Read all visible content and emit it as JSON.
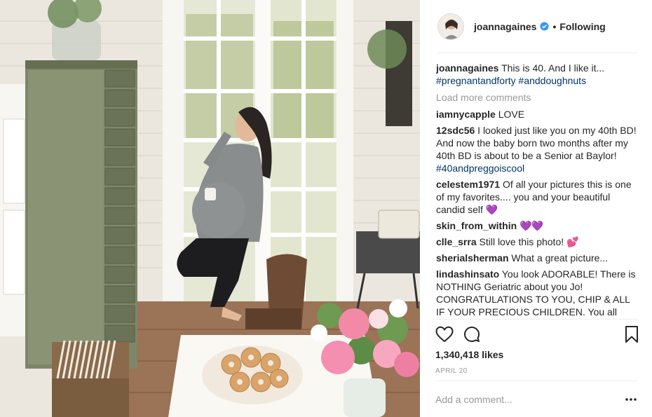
{
  "post": {
    "username": "joannagaines",
    "follow_state": "Following",
    "dot": "•",
    "caption": {
      "username": "joannagaines",
      "text": "This is 40. And I like it...",
      "hashtags": [
        "#pregnantandforty",
        "#anddoughnuts"
      ]
    },
    "load_more_label": "Load more comments",
    "comments": [
      {
        "username": "iamnycapple",
        "text": "LOVE",
        "tag": "",
        "emoji": ""
      },
      {
        "username": "12sdc56",
        "text": "I looked just like you on my 40th BD! And now the baby born two months after my 40th BD is about to be a Senior at Baylor!",
        "tag": "#40andpreggoiscool",
        "emoji": ""
      },
      {
        "username": "celestem1971",
        "text": "Of all your pictures this is one of my favorites.... you and your beautiful candid self",
        "tag": "",
        "emoji": "💜"
      },
      {
        "username": "skin_from_within",
        "text": "",
        "tag": "",
        "emoji": "💜💜"
      },
      {
        "username": "clle_srra",
        "text": "Still love this photo!",
        "tag": "",
        "emoji": "💕"
      },
      {
        "username": "sherialsherman",
        "text": "What a great picture...",
        "tag": "",
        "emoji": ""
      },
      {
        "username": "lindashinsato",
        "text": "You look ADORABLE! There is NOTHING Geriatric about you Jo! CONGRATULATIONS TO YOU, CHIP & ALL IF YOUR PRECIOUS CHILDREN. You all",
        "tag": "",
        "emoji": ""
      }
    ],
    "likes_text": "1,340,418 likes",
    "date_text": "APRIL 20",
    "add_comment_placeholder": "Add a comment...",
    "more_options": "•••",
    "icons": {
      "verified": "verified-badge-icon",
      "like": "heart-icon",
      "comment": "comment-bubble-icon",
      "save": "bookmark-icon",
      "more": "more-options-icon"
    },
    "colors": {
      "hashtag": "#003569",
      "verified": "#3897f0",
      "muted": "#999999",
      "text": "#262626"
    }
  }
}
